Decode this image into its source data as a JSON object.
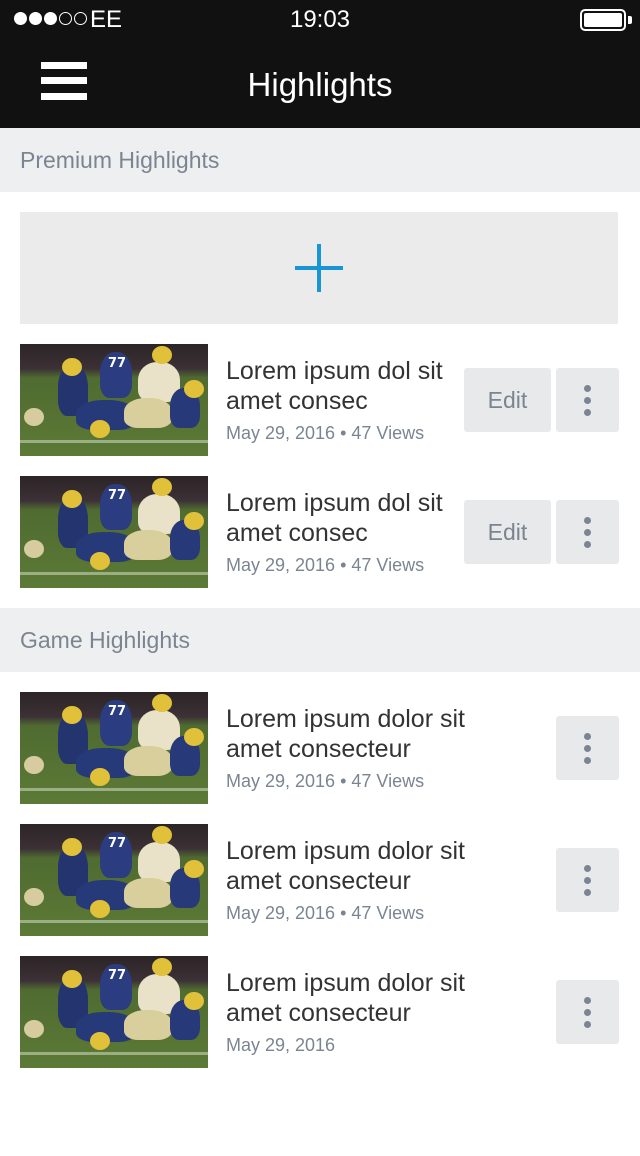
{
  "status_bar": {
    "carrier": "EE",
    "time": "19:03"
  },
  "nav": {
    "title": "Highlights"
  },
  "premium": {
    "header": "Premium Highlights",
    "items": [
      {
        "title": "Lorem ipsum dol sit amet consec",
        "meta": "May 29, 2016 • 47 Views",
        "edit_label": "Edit"
      },
      {
        "title": "Lorem ipsum dol sit amet consec",
        "meta": "May 29, 2016 • 47 Views",
        "edit_label": "Edit"
      }
    ]
  },
  "game": {
    "header": "Game Highlights",
    "items": [
      {
        "title": "Lorem ipsum dolor sit amet consecteur",
        "meta": "May 29, 2016 • 47 Views"
      },
      {
        "title": "Lorem ipsum dolor sit amet consecteur",
        "meta": "May 29, 2016 • 47 Views"
      },
      {
        "title": "Lorem ipsum dolor sit amet consecteur",
        "meta": "May 29, 2016"
      }
    ]
  },
  "thumbnail": {
    "jersey_number": "77"
  },
  "icons": {
    "menu": "hamburger-menu-icon",
    "add": "plus-icon",
    "more": "vertical-ellipsis-icon",
    "battery": "battery-icon",
    "signal": "signal-strength-icon"
  },
  "colors": {
    "bar_background": "#111111",
    "accent": "#1a95d4",
    "section_background": "#eeeff1",
    "muted_text": "#7b8591"
  }
}
